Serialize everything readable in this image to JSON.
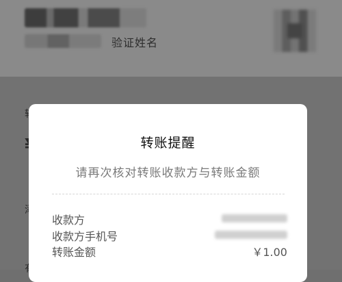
{
  "background": {
    "verify_name_link": "验证姓名",
    "fragments": [
      "转",
      "¥",
      "添",
      "有"
    ]
  },
  "dialog": {
    "title": "转账提醒",
    "subtitle": "请再次核对转账收款方与转账金额",
    "rows": [
      {
        "label": "收款方",
        "value": ""
      },
      {
        "label": "收款方手机号",
        "value": ""
      },
      {
        "label": "转账金额",
        "value": "￥1.00"
      }
    ]
  }
}
